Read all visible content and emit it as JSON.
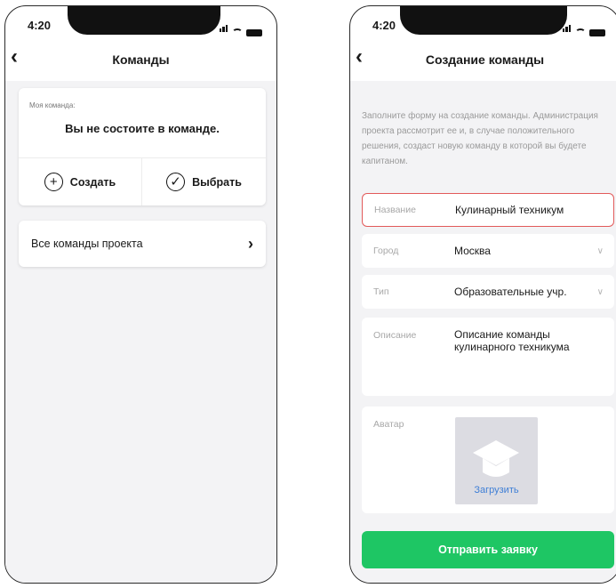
{
  "status_bar": {
    "time": "4:20"
  },
  "team_screen": {
    "title": "Команды",
    "my_team_label": "Моя команда:",
    "no_team_text": "Вы не состоите в команде.",
    "create_label": "Создать",
    "choose_label": "Выбрать",
    "all_teams_label": "Все команды проекта"
  },
  "create_screen": {
    "title": "Создание команды",
    "intro": "Заполните форму на создание команды. Администрация проекта рассмотрит ее и, в случае положительного решения, создаст новую команду в которой вы будете капитаном.",
    "fields": {
      "name": {
        "label": "Название",
        "value": "Кулинарный техникум"
      },
      "city": {
        "label": "Город",
        "value": "Москва"
      },
      "type": {
        "label": "Тип",
        "value": "Образовательные учр."
      },
      "description": {
        "label": "Описание",
        "value": "Описание команды кулинарного техникума"
      },
      "avatar": {
        "label": "Аватар",
        "upload_label": "Загрузить"
      }
    },
    "submit_label": "Отправить заявку"
  },
  "colors": {
    "accent_green": "#1ec664",
    "error_border": "#e25a5a",
    "link_blue": "#3f7fd6"
  }
}
